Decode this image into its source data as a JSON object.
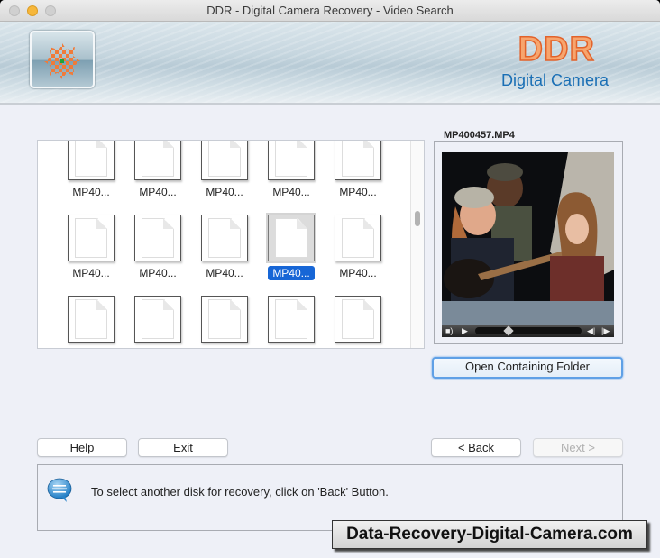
{
  "window": {
    "title": "DDR - Digital Camera Recovery - Video Search"
  },
  "banner": {
    "brand": "DDR",
    "subtitle": "Digital Camera",
    "colors": {
      "brand_orange": "#f07b3a",
      "subtitle_blue": "#1a6fb5"
    }
  },
  "file_grid": {
    "rows": [
      [
        {
          "label": "MP40...",
          "selected": false
        },
        {
          "label": "MP40...",
          "selected": false
        },
        {
          "label": "MP40...",
          "selected": false
        },
        {
          "label": "MP40...",
          "selected": false
        },
        {
          "label": "MP40...",
          "selected": false
        }
      ],
      [
        {
          "label": "MP40...",
          "selected": false
        },
        {
          "label": "MP40...",
          "selected": false
        },
        {
          "label": "MP40...",
          "selected": false
        },
        {
          "label": "MP40...",
          "selected": true
        },
        {
          "label": "MP40...",
          "selected": false
        }
      ],
      [
        {
          "label": "",
          "selected": false
        },
        {
          "label": "",
          "selected": false
        },
        {
          "label": "",
          "selected": false
        },
        {
          "label": "",
          "selected": false
        },
        {
          "label": "",
          "selected": false
        }
      ]
    ],
    "icon": "document-icon",
    "selection_color": "#1766d6"
  },
  "preview": {
    "filename": "MP400457.MP4",
    "controls": {
      "volume_icon": "speaker-icon",
      "play_icon": "play-icon",
      "prev_frame_icon": "step-back-icon",
      "next_frame_icon": "step-forward-icon",
      "progress": 0.3
    },
    "open_folder_label": "Open Containing Folder"
  },
  "buttons": {
    "help": "Help",
    "exit": "Exit",
    "back": "< Back",
    "next": "Next >"
  },
  "status": {
    "icon": "chat-bubble-icon",
    "message": "To select another disk for recovery, click on 'Back' Button."
  },
  "watermark": "Data-Recovery-Digital-Camera.com"
}
